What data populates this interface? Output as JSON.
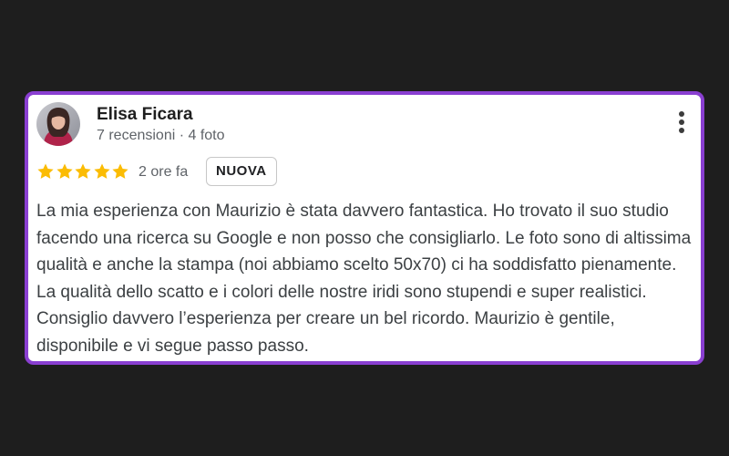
{
  "review": {
    "author_name": "Elisa Ficara",
    "author_meta": "7 recensioni · 4 foto",
    "rating": 5,
    "rating_max": 5,
    "time_ago": "2 ore fa",
    "badge": "NUOVA",
    "text": "La mia esperienza con Maurizio è stata davvero fantastica. Ho trovato il suo studio facendo una ricerca su Google e non posso che consigliarlo. Le foto sono di altissima qualità e anche la stampa (noi abbiamo scelto 50x70) ci ha soddisfatto pienamente. La qualità dello scatto e i colori delle nostre iridi sono stupendi e super realistici. Consiglio davvero l’esperienza per creare un bel ricordo. Maurizio è gentile, disponibile e vi segue passo passo."
  },
  "icons": {
    "star": "star-icon",
    "menu": "more-vert-icon",
    "avatar": "user-avatar"
  },
  "colors": {
    "background": "#1e1e1e",
    "card_border": "#8a3fd1",
    "star": "#fbbc04",
    "text": "#3c4043",
    "secondary_text": "#5f6368"
  }
}
